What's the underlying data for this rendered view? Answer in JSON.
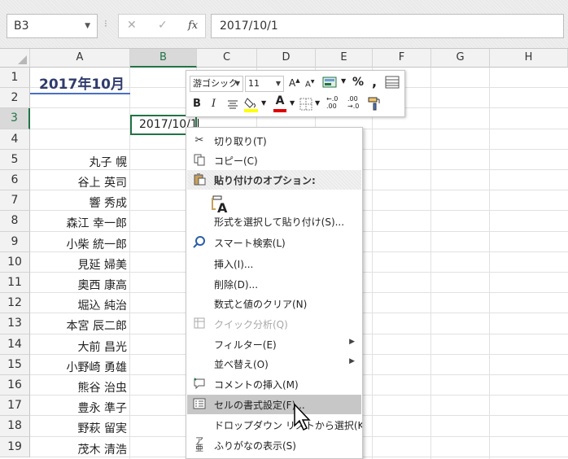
{
  "formula_bar": {
    "name_box": "B3",
    "cancel_icon": "✕",
    "enter_icon": "✓",
    "fx_label": "fx",
    "formula_value": "2017/10/1"
  },
  "columns": [
    "A",
    "B",
    "C",
    "D",
    "E",
    "F",
    "G",
    "H"
  ],
  "rows": [
    "1",
    "2",
    "3",
    "4",
    "5",
    "6",
    "7",
    "8",
    "9",
    "10",
    "11",
    "12",
    "13",
    "14",
    "15",
    "16",
    "17",
    "18",
    "19"
  ],
  "cells": {
    "a1": "2017年10月",
    "b3": "2017/10/1",
    "names": [
      "丸子 幌",
      "谷上 英司",
      "響 秀成",
      "森江 幸一郎",
      "小柴 統一郎",
      "見延 婦美",
      "奧西 康高",
      "堀込 純治",
      "本宮 辰二郎",
      "大前 昌光",
      "小野崎 勇雄",
      "熊谷 治虫",
      "豊永 準子",
      "野萩 留実",
      "茂木 清浩"
    ]
  },
  "mini_toolbar": {
    "font_name": "游ゴシック",
    "font_size": "11",
    "grow_font": "A",
    "shrink_font": "A",
    "percent": "%",
    "comma": ",",
    "bold": "B",
    "italic": "I",
    "font_color_letter": "A",
    "inc_decimal": "←.0 .00",
    "dec_decimal": ".00 →.0"
  },
  "context_menu": {
    "items": [
      {
        "label": "切り取り(T)",
        "icon": "scissors-icon"
      },
      {
        "label": "コピー(C)",
        "icon": "copy-icon"
      },
      {
        "label": "貼り付けのオプション:",
        "icon": "paste-icon"
      },
      {
        "label": "形式を選択して貼り付け(S)...",
        "icon": ""
      },
      {
        "label": "スマート検索(L)",
        "icon": "search-icon"
      },
      {
        "label": "挿入(I)...",
        "icon": ""
      },
      {
        "label": "削除(D)...",
        "icon": ""
      },
      {
        "label": "数式と値のクリア(N)",
        "icon": ""
      },
      {
        "label": "クイック分析(Q)",
        "icon": "quick-analysis-icon"
      },
      {
        "label": "フィルター(E)",
        "icon": ""
      },
      {
        "label": "並べ替え(O)",
        "icon": ""
      },
      {
        "label": "コメントの挿入(M)",
        "icon": "comment-icon"
      },
      {
        "label": "セルの書式設定(F)...",
        "icon": "format-cells-icon"
      },
      {
        "label": "ドロップダウン リストから選択(K)...",
        "icon": ""
      },
      {
        "label": "ふりがなの表示(S)",
        "icon": "furigana-icon"
      }
    ],
    "paste_option_letter": "A"
  }
}
